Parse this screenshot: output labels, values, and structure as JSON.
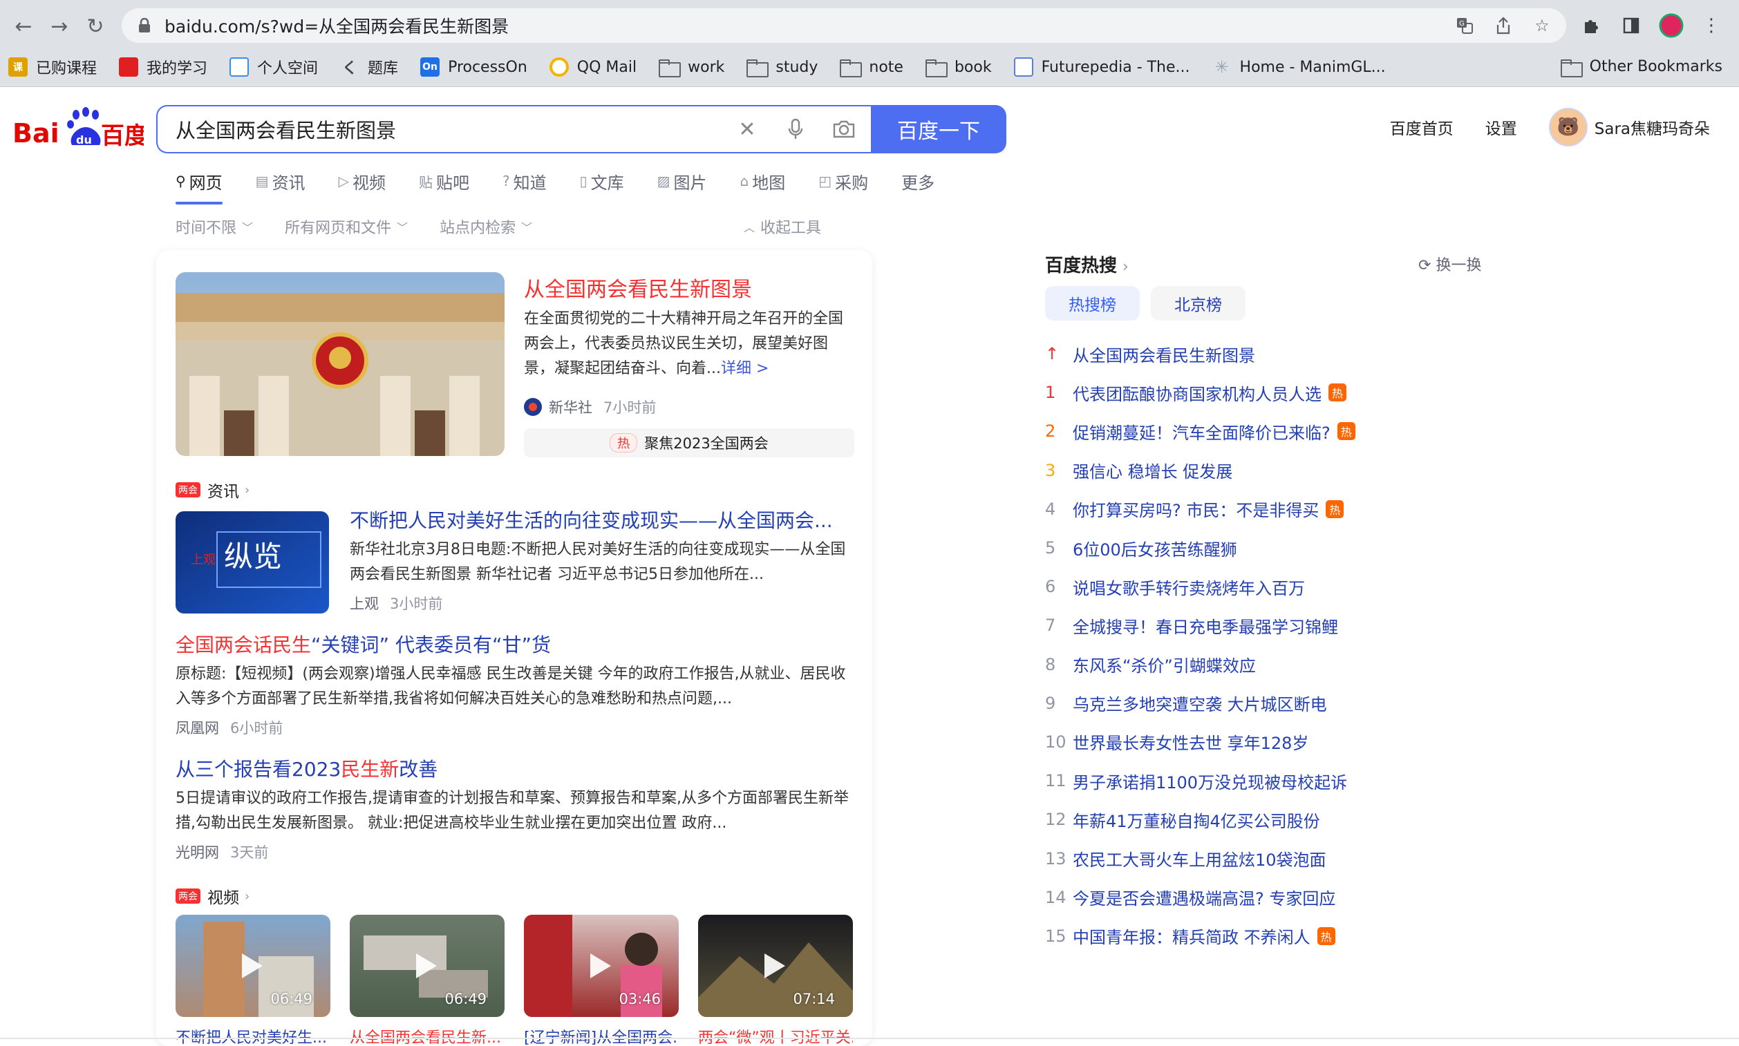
{
  "browser": {
    "url": "baidu.com/s?wd=从全国两会看民生新图景",
    "bookmarks": [
      {
        "label": "已购课程",
        "icon": "course-icon",
        "color": "#e0a000",
        "glyph": "课"
      },
      {
        "label": "我的学习",
        "icon": "study-book-icon",
        "color": "#e02020",
        "glyph": "■"
      },
      {
        "label": "个人空间",
        "icon": "tv-icon",
        "color": "#3a8ee6",
        "glyph": "▣"
      },
      {
        "label": "题库",
        "icon": "question-bank-icon",
        "color": "#444444",
        "glyph": "く"
      },
      {
        "label": "ProcessOn",
        "icon": "processon-icon",
        "color": "#1f6fe5",
        "glyph": "On"
      },
      {
        "label": "QQ Mail",
        "icon": "qq-mail-icon",
        "color": "#f4b400",
        "glyph": "◉"
      },
      {
        "label": "work",
        "icon": "folder-icon"
      },
      {
        "label": "study",
        "icon": "folder-icon"
      },
      {
        "label": "note",
        "icon": "folder-icon"
      },
      {
        "label": "book",
        "icon": "folder-icon"
      },
      {
        "label": "Futurepedia - The...",
        "icon": "futurepedia-icon",
        "color": "#5b7fd6",
        "glyph": "▤"
      },
      {
        "label": "Home - ManimGL...",
        "icon": "manim-icon",
        "color": "#9aa6b2",
        "glyph": "✳"
      }
    ],
    "other_bookmarks": "Other Bookmarks"
  },
  "search": {
    "query": "从全国两会看民生新图景",
    "button": "百度一下"
  },
  "user_nav": {
    "home": "百度首页",
    "settings": "设置",
    "username": "Sara焦糖玛奇朵"
  },
  "tabs": [
    {
      "label": "网页",
      "icon": "search-icon",
      "glyph": "⚲"
    },
    {
      "label": "资讯",
      "icon": "news-icon",
      "glyph": "▤"
    },
    {
      "label": "视频",
      "icon": "video-icon",
      "glyph": "▷"
    },
    {
      "label": "贴吧",
      "icon": "tieba-icon",
      "glyph": "贴"
    },
    {
      "label": "知道",
      "icon": "question-icon",
      "glyph": "?"
    },
    {
      "label": "文库",
      "icon": "document-icon",
      "glyph": "▯"
    },
    {
      "label": "图片",
      "icon": "image-icon",
      "glyph": "▨"
    },
    {
      "label": "地图",
      "icon": "map-icon",
      "glyph": "⌂"
    },
    {
      "label": "采购",
      "icon": "shopping-icon",
      "glyph": "◰"
    },
    {
      "label": "更多",
      "icon": "",
      "glyph": ""
    }
  ],
  "tools": {
    "time": "时间不限",
    "filetype": "所有网页和文件",
    "site": "站点内检索",
    "collapse": "收起工具"
  },
  "featured": {
    "title": "从全国两会看民生新图景",
    "abstract": "在全面贯彻党的二十大精神开局之年召开的全国两会上，代表委员热议民生关切，展望美好图景，凝聚起团结奋斗、向着...",
    "more": "详细 >",
    "source": "新华社",
    "time": "7小时前",
    "tag_pill": "热",
    "tag_text": "聚焦2023全国两会"
  },
  "news_section": {
    "badge": "两会",
    "label": "资讯"
  },
  "results": [
    {
      "title": "不断把人民对美好生活的向往变成现实——从全国两会...",
      "abstract": "新华社北京3月8日电题:不断把人民对美好生活的向往变成现实——从全国两会看民生新图景 新华社记者 习近平总书记5日参加他所在...",
      "source": "上观",
      "time": "3小时前",
      "thumb_text": "纵览",
      "thumb_side": "上观"
    },
    {
      "title_parts": [
        "全国两会话",
        "民生",
        "“关键词” 代表委员有“甘”货"
      ],
      "abstract": "原标题:【短视频】(两会观察)增强人民幸福感 民生改善是关键 今年的政府工作报告,从就业、居民收入等多个方面部署了民生新举措,我省将如何解决百姓关心的急难愁盼和热点问题,...",
      "source": "凤凰网",
      "time": "6小时前"
    },
    {
      "title_parts": [
        "从三个报告看2023",
        "民生新",
        "改善"
      ],
      "abstract": "5日提请审议的政府工作报告,提请审查的计划报告和草案、预算报告和草案,从多个方面部署民生新举措,勾勒出民生发展新图景。 就业:把促进高校毕业生就业摆在更加突出位置 政府...",
      "source": "光明网",
      "time": "3天前"
    }
  ],
  "video_section": {
    "badge": "两会",
    "label": "视频"
  },
  "videos": [
    {
      "duration": "06:49",
      "caption": "不断把人民对美好生..."
    },
    {
      "duration": "06:49",
      "caption": "从全国两会看民生新..."
    },
    {
      "duration": "03:46",
      "caption": "[辽宁新闻]从全国两会..."
    },
    {
      "duration": "07:14",
      "caption": "两会“微”观丨习近平关..."
    }
  ],
  "hot": {
    "title": "百度热搜",
    "refresh": "换一换",
    "tabs": [
      "热搜榜",
      "北京榜"
    ],
    "items": [
      {
        "rank": "↑",
        "text": "从全国两会看民生新图景",
        "hot": false,
        "color": "#f73131"
      },
      {
        "rank": "1",
        "text": "代表团酝酿协商国家机构人员人选",
        "hot": true,
        "color": "#f73131"
      },
      {
        "rank": "2",
        "text": "促销潮蔓延！汽车全面降价已来临?",
        "hot": true,
        "color": "#ff6600"
      },
      {
        "rank": "3",
        "text": "强信心 稳增长 促发展",
        "hot": false,
        "color": "#faa90e"
      },
      {
        "rank": "4",
        "text": "你打算买房吗? 市民：不是非得买",
        "hot": true,
        "color": "#9195a3"
      },
      {
        "rank": "5",
        "text": "6位00后女孩苦练醒狮",
        "hot": false,
        "color": "#9195a3"
      },
      {
        "rank": "6",
        "text": "说唱女歌手转行卖烧烤年入百万",
        "hot": false,
        "color": "#9195a3"
      },
      {
        "rank": "7",
        "text": "全城搜寻！春日充电季最强学习锦鲤",
        "hot": false,
        "color": "#9195a3"
      },
      {
        "rank": "8",
        "text": "东风系“杀价”引蝴蝶效应",
        "hot": false,
        "color": "#9195a3"
      },
      {
        "rank": "9",
        "text": "乌克兰多地突遭空袭 大片城区断电",
        "hot": false,
        "color": "#9195a3"
      },
      {
        "rank": "10",
        "text": "世界最长寿女性去世 享年128岁",
        "hot": false,
        "color": "#9195a3"
      },
      {
        "rank": "11",
        "text": "男子承诺捐1100万没兑现被母校起诉",
        "hot": false,
        "color": "#9195a3"
      },
      {
        "rank": "12",
        "text": "年薪41万董秘自掏4亿买公司股份",
        "hot": false,
        "color": "#9195a3"
      },
      {
        "rank": "13",
        "text": "农民工大哥火车上用盆炫10袋泡面",
        "hot": false,
        "color": "#9195a3"
      },
      {
        "rank": "14",
        "text": "今夏是否会遭遇极端高温? 专家回应",
        "hot": false,
        "color": "#9195a3"
      },
      {
        "rank": "15",
        "text": "中国青年报：精兵简政 不养闲人",
        "hot": true,
        "color": "#9195a3"
      }
    ],
    "hot_label": "热"
  }
}
